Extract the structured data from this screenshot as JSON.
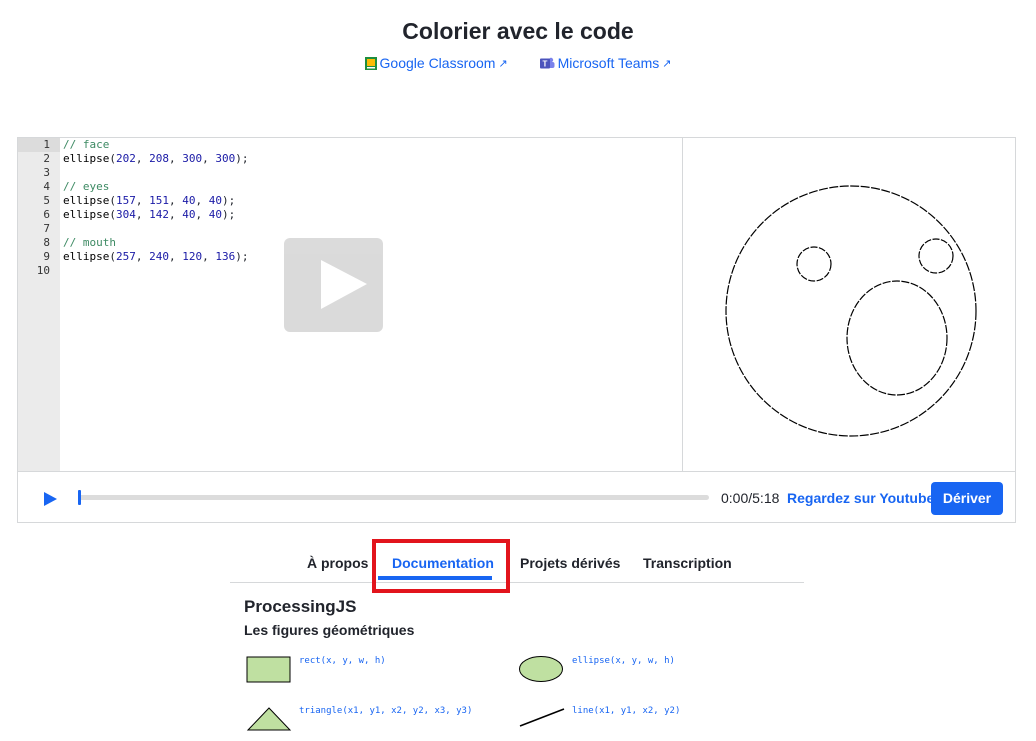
{
  "header": {
    "title": "Colorier avec le code",
    "classroom_label": "Google Classroom",
    "teams_label": "Microsoft Teams"
  },
  "editor": {
    "line_numbers": [
      "1",
      "2",
      "3",
      "4",
      "5",
      "6",
      "7",
      "8",
      "9",
      "10"
    ],
    "lines": [
      {
        "comment": "// face"
      },
      {
        "call": "ellipse",
        "args": [
          "202",
          "208",
          "300",
          "300"
        ]
      },
      {},
      {
        "comment": "// eyes"
      },
      {
        "call": "ellipse",
        "args": [
          "157",
          "151",
          "40",
          "40"
        ]
      },
      {
        "call": "ellipse",
        "args": [
          "304",
          "142",
          "40",
          "40"
        ]
      },
      {},
      {
        "comment": "// mouth"
      },
      {
        "call": "ellipse",
        "args": [
          "257",
          "240",
          "120",
          "136"
        ]
      },
      {}
    ]
  },
  "player": {
    "time": "0:00/5:18",
    "youtube_label": "Regardez sur Youtube",
    "fork_label": "Dériver",
    "progress": 0
  },
  "tabs": {
    "items": [
      "À propos",
      "Documentation",
      "Projets dérivés",
      "Transcription"
    ],
    "selected": "Documentation"
  },
  "docs": {
    "heading": "ProcessingJS",
    "subheading": "Les figures géométriques",
    "rect_sig": "rect(x, y, w, h)",
    "ellipse_sig": "ellipse(x, y, w, h)",
    "triangle_sig": "triangle(x1, y1, x2, y2, x3, y3)",
    "line_sig": "line(x1, y1, x2, y2)",
    "shape_fill": "#bfe0a1"
  },
  "colors": {
    "accent": "#1865f2",
    "highlight": "#e2141c"
  }
}
